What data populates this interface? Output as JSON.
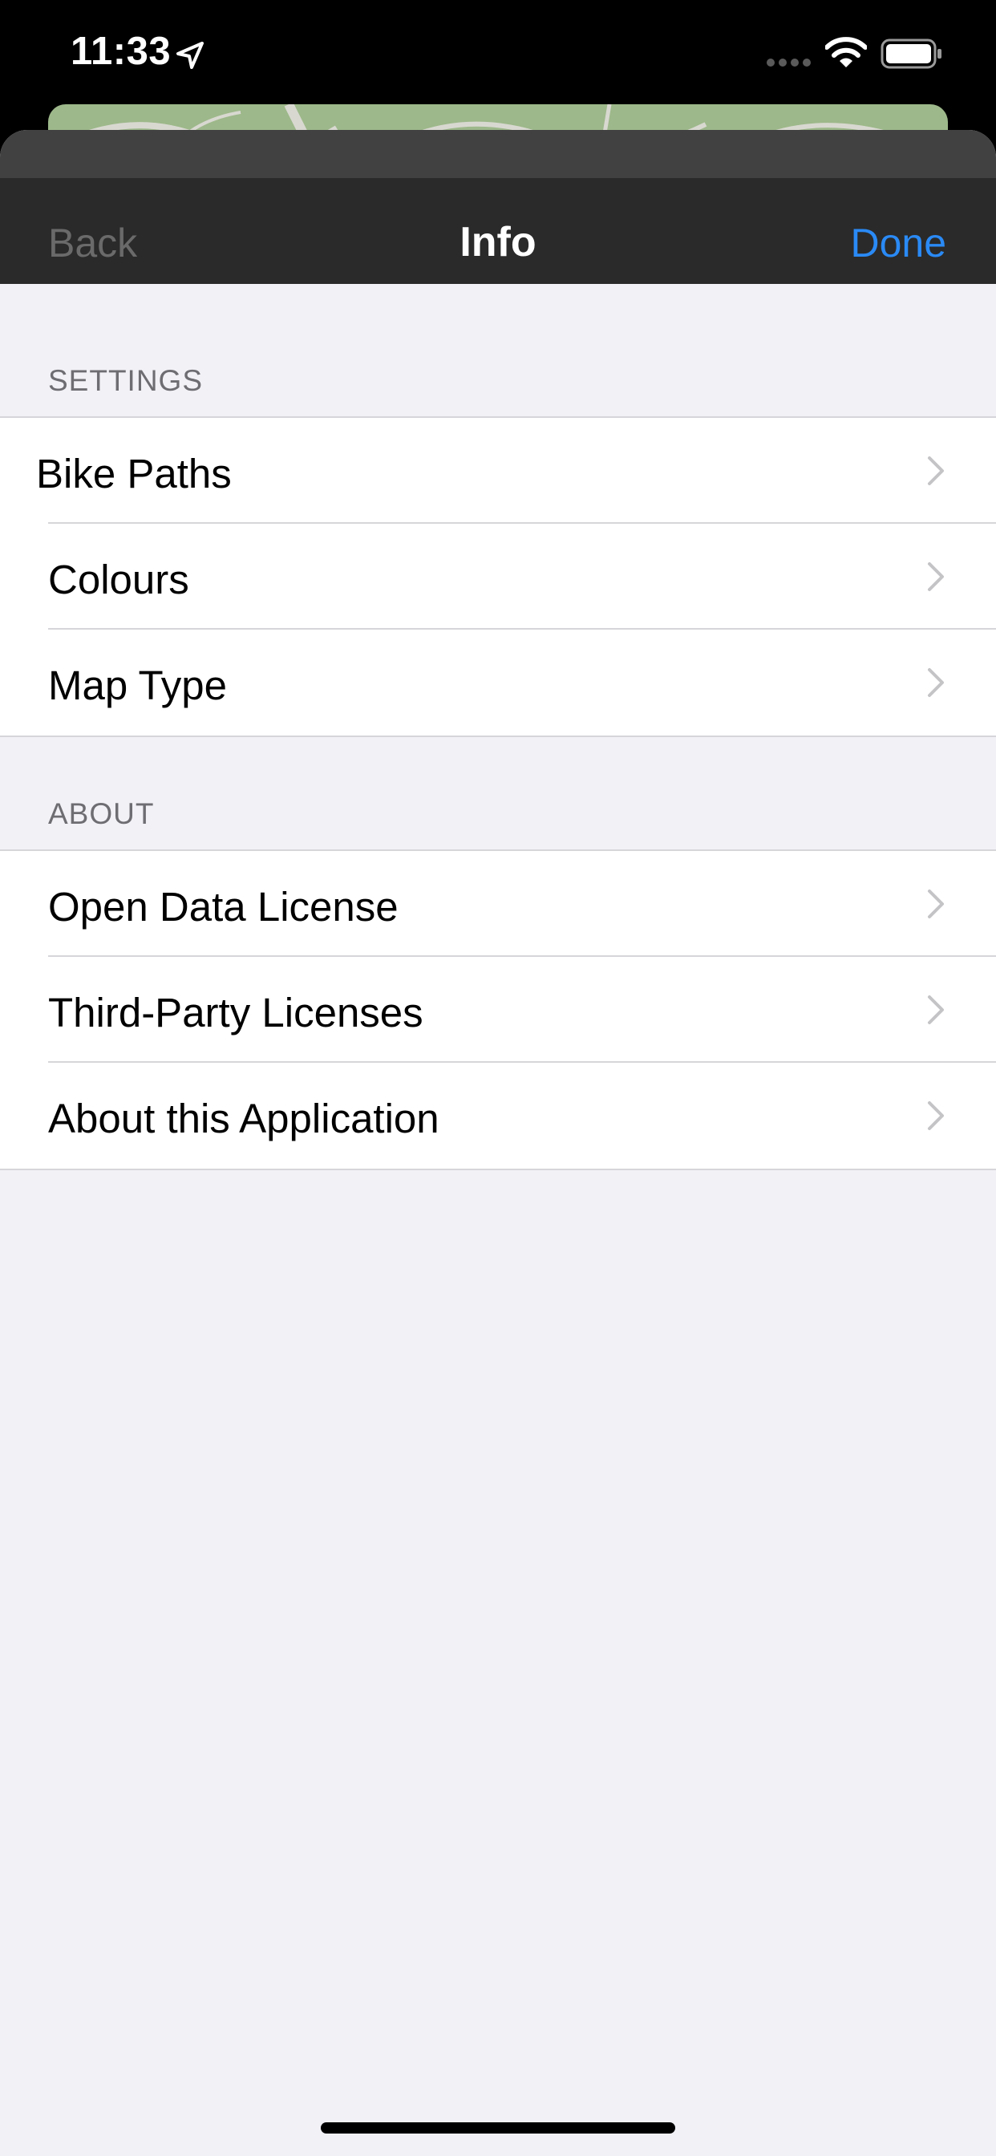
{
  "status_bar": {
    "time": "11:33",
    "icons": [
      "location-arrow-icon",
      "cellular-signal-icon",
      "wifi-icon",
      "battery-icon"
    ]
  },
  "nav": {
    "back_label": "Back",
    "title": "Info",
    "done_label": "Done"
  },
  "sections": [
    {
      "header": "SETTINGS",
      "items": [
        {
          "label": "Bike Paths"
        },
        {
          "label": "Colours"
        },
        {
          "label": "Map Type"
        }
      ]
    },
    {
      "header": "ABOUT",
      "items": [
        {
          "label": "Open Data License"
        },
        {
          "label": "Third-Party Licenses"
        },
        {
          "label": "About this Application"
        }
      ]
    }
  ],
  "colors": {
    "accent": "#2a8af5",
    "background": "#f1f1f6",
    "nav_bar": "#2a2a2a",
    "map_green": "#9db88a"
  }
}
